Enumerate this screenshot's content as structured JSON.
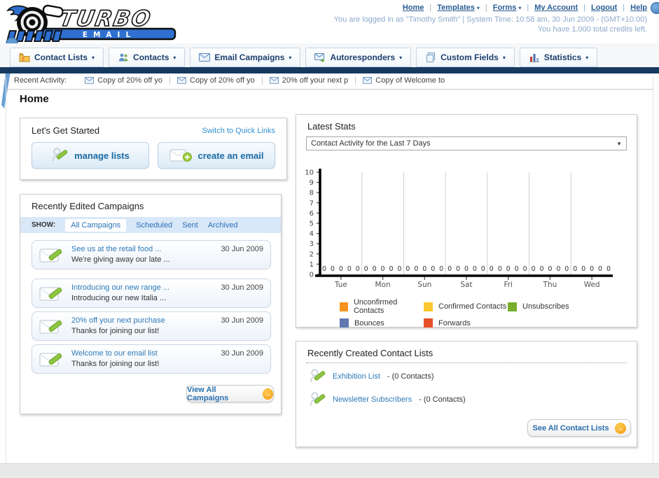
{
  "header": {
    "logo_line1": "TURBO",
    "logo_line2": "EMAIL",
    "nav_links": [
      {
        "label": "Home"
      },
      {
        "label": "Templates"
      },
      {
        "label": "Forms"
      },
      {
        "label": "My Account"
      },
      {
        "label": "Logout"
      },
      {
        "label": "Help"
      }
    ],
    "login_status": "You are logged in as \"Timothy Smith\" | System Time: 10:58 am, 30 Jun 2009 - (GMT+10:00)",
    "credits": "You have 1,000 total credits left."
  },
  "nav_tabs": [
    {
      "label": "Contact Lists"
    },
    {
      "label": "Contacts"
    },
    {
      "label": "Email Campaigns"
    },
    {
      "label": "Autoresponders"
    },
    {
      "label": "Custom Fields"
    },
    {
      "label": "Statistics"
    }
  ],
  "recent_activity": {
    "label": "Recent Activity:",
    "items": [
      "Copy of 20% off yo",
      "Copy of 20% off yo",
      "20% off your next p",
      "Copy of Welcome to"
    ]
  },
  "page_title": "Home",
  "get_started": {
    "title": "Let's Get Started",
    "switch_link": "Switch to Quick Links",
    "buttons": [
      {
        "label": "manage lists"
      },
      {
        "label": "create an email"
      }
    ]
  },
  "campaigns": {
    "title": "Recently Edited Campaigns",
    "show_label": "SHOW:",
    "filters": [
      "All Campaigns",
      "Scheduled",
      "Sent",
      "Archived"
    ],
    "active_filter": "All Campaigns",
    "items": [
      {
        "title": "See us at the retail food ...",
        "subtitle": "We're giving away our late ...",
        "date": "30 Jun 2009"
      },
      {
        "title": "Introducing our new range ...",
        "subtitle": "Introducing our new Italia ...",
        "date": "30 Jun 2009"
      },
      {
        "title": "20% off your next purchase",
        "subtitle": "Thanks for joining our list!",
        "date": "30 Jun 2009"
      },
      {
        "title": "Welcome to our email list",
        "subtitle": "Thanks for joining our list!",
        "date": "30 Jun 2009"
      }
    ],
    "view_all_label": "View All Campaigns"
  },
  "stats": {
    "title": "Latest Stats",
    "selected_option": "Contact Activity for the Last 7 Days"
  },
  "chart_data": {
    "type": "bar",
    "title": "Contact Activity for the Last 7 Days",
    "categories": [
      "Tue",
      "Mon",
      "Sun",
      "Sat",
      "Fri",
      "Thu",
      "Wed"
    ],
    "series": [
      {
        "name": "Unconfirmed Contacts",
        "color": "#f6921e",
        "values": [
          0,
          0,
          0,
          0,
          0,
          0,
          0
        ]
      },
      {
        "name": "Confirmed Contacts",
        "color": "#fdc72f",
        "values": [
          0,
          0,
          0,
          0,
          0,
          0,
          0
        ]
      },
      {
        "name": "Unsubscribes",
        "color": "#79ae2c",
        "values": [
          0,
          0,
          0,
          0,
          0,
          0,
          0
        ]
      },
      {
        "name": "Bounces",
        "color": "#6278b1",
        "values": [
          0,
          0,
          0,
          0,
          0,
          0,
          0
        ]
      },
      {
        "name": "Forwards",
        "color": "#e8502a",
        "values": [
          0,
          0,
          0,
          0,
          0,
          0,
          0
        ]
      }
    ],
    "ylim": [
      0,
      10
    ],
    "xlabel": "",
    "ylabel": "",
    "grid": "vertical-only",
    "legend_position": "bottom",
    "value_labels": true
  },
  "contact_lists": {
    "title": "Recently Created Contact Lists",
    "items": [
      {
        "name": "Exhibition List",
        "count": "- (0 Contacts)"
      },
      {
        "name": "Newsletter Subscribers",
        "count": "- (0 Contacts)"
      }
    ],
    "see_all_label": "See All Contact Lists"
  }
}
